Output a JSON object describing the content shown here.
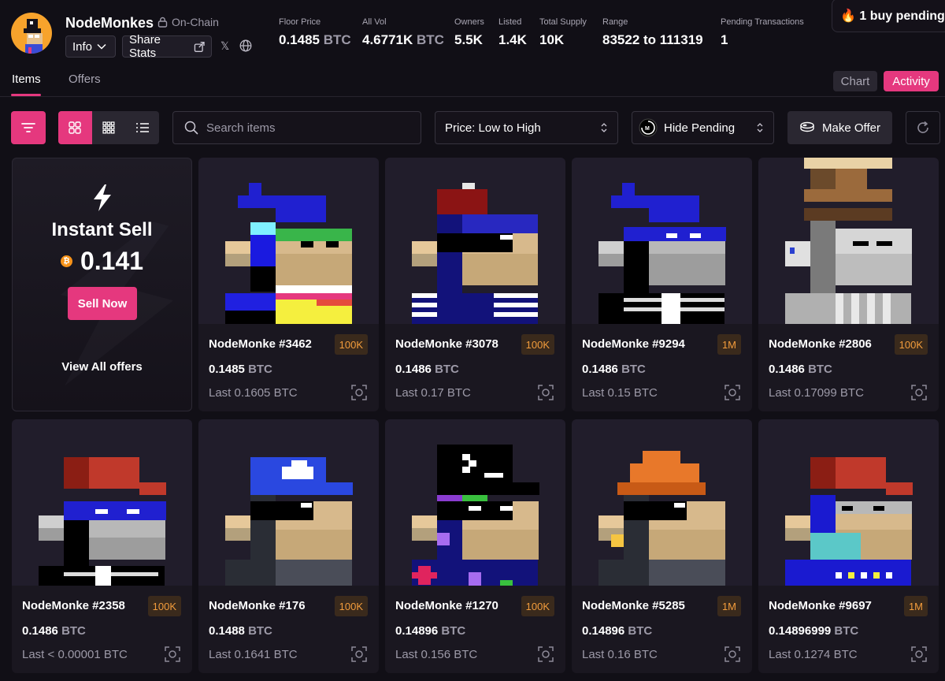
{
  "header": {
    "collection_name": "NodeMonkes",
    "onchain_label": "On-Chain",
    "info_label": "Info",
    "share_label": "Share Stats",
    "stats": [
      {
        "label": "Floor Price",
        "value": "0.1485",
        "unit": "BTC"
      },
      {
        "label": "All Vol",
        "value": "4.6771K",
        "unit": "BTC"
      },
      {
        "label": "Owners",
        "value": "5.5K",
        "unit": ""
      },
      {
        "label": "Listed",
        "value": "1.4K",
        "unit": ""
      },
      {
        "label": "Total Supply",
        "value": "10K",
        "unit": ""
      },
      {
        "label": "Range",
        "value": "83522 to 111319",
        "unit": ""
      },
      {
        "label": "Pending Transactions",
        "value": "1",
        "unit": ""
      }
    ],
    "pending_pill": "🔥 1 buy pending..."
  },
  "tabs": [
    {
      "label": "Items",
      "active": true
    },
    {
      "label": "Offers",
      "active": false
    }
  ],
  "panel_buttons": {
    "chart": "Chart",
    "activity": "Activity"
  },
  "toolbar": {
    "search_placeholder": "Search items",
    "sort_value": "Price: Low to High",
    "pending_filter": "Hide Pending",
    "make_offer": "Make Offer"
  },
  "instant_sell": {
    "title": "Instant Sell",
    "price": "0.141",
    "button": "Sell Now",
    "view_all": "View All offers"
  },
  "items": [
    {
      "name": "NodeMonke #3462",
      "badge": "100K",
      "price": "0.1485",
      "unit": "BTC",
      "last": "Last 0.1605 BTC"
    },
    {
      "name": "NodeMonke #3078",
      "badge": "100K",
      "price": "0.1486",
      "unit": "BTC",
      "last": "Last 0.17 BTC"
    },
    {
      "name": "NodeMonke #9294",
      "badge": "1M",
      "price": "0.1486",
      "unit": "BTC",
      "last": "Last 0.15 BTC"
    },
    {
      "name": "NodeMonke #2806",
      "badge": "100K",
      "price": "0.1486",
      "unit": "BTC",
      "last": "Last 0.17099 BTC"
    },
    {
      "name": "NodeMonke #2358",
      "badge": "100K",
      "price": "0.1486",
      "unit": "BTC",
      "last": "Last < 0.00001 BTC"
    },
    {
      "name": "NodeMonke #176",
      "badge": "100K",
      "price": "0.1488",
      "unit": "BTC",
      "last": "Last 0.1641 BTC"
    },
    {
      "name": "NodeMonke #1270",
      "badge": "100K",
      "price": "0.14896",
      "unit": "BTC",
      "last": "Last 0.156 BTC"
    },
    {
      "name": "NodeMonke #5285",
      "badge": "1M",
      "price": "0.14896",
      "unit": "BTC",
      "last": "Last 0.16 BTC"
    },
    {
      "name": "NodeMonke #9697",
      "badge": "1M",
      "price": "0.14896999",
      "unit": "BTC",
      "last": "Last 0.1274 BTC"
    }
  ],
  "colors": {
    "accent": "#e5387e",
    "background": "#110f16",
    "card": "#1a1720",
    "badge_text": "#f29c3c"
  }
}
